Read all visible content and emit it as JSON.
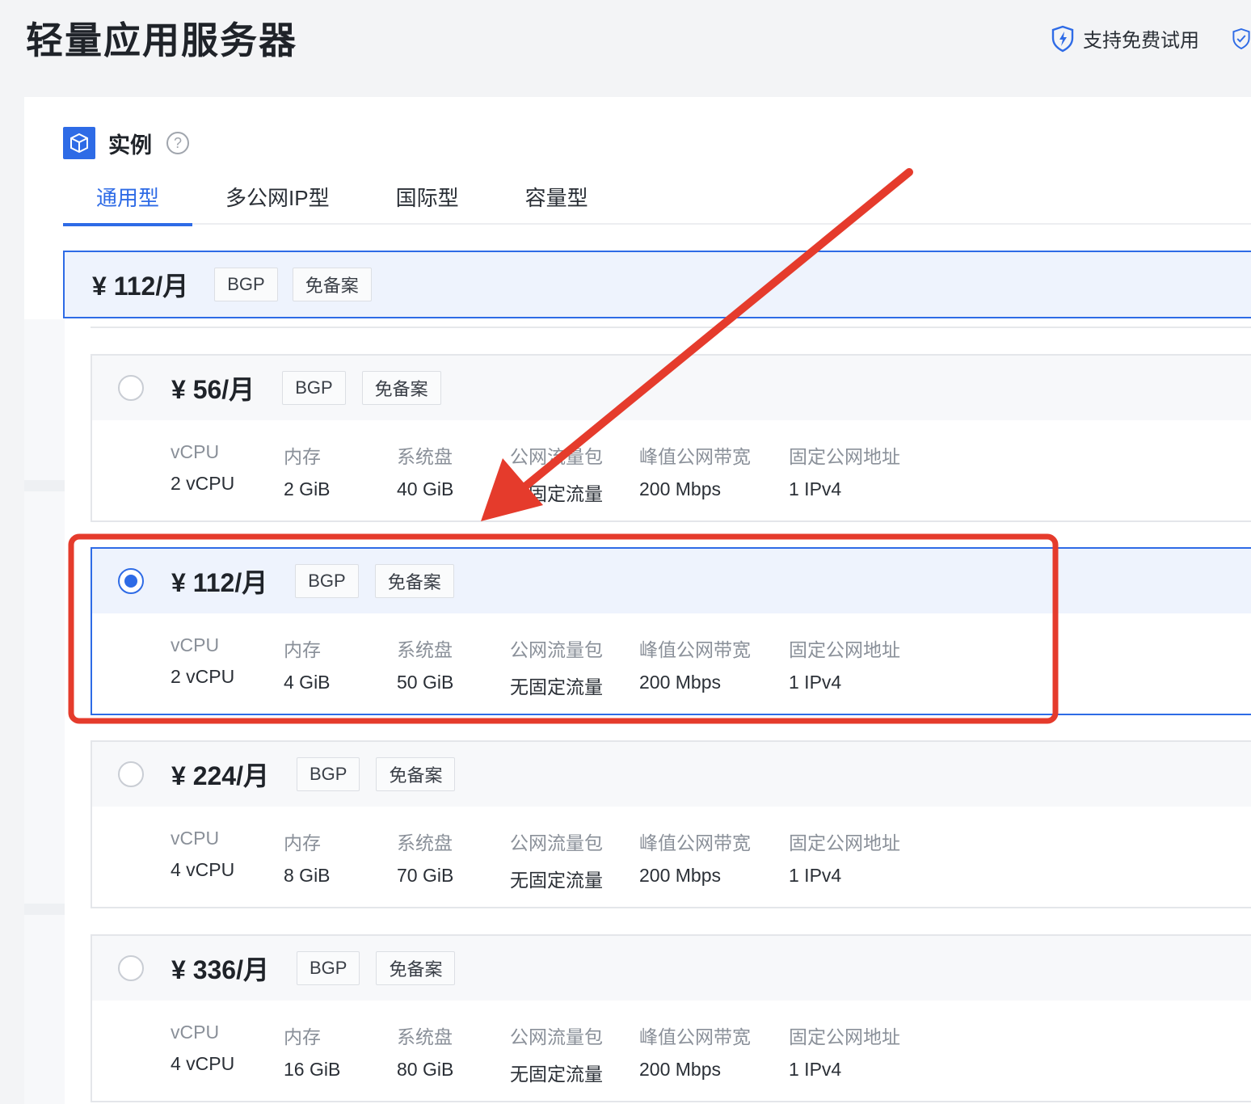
{
  "page": {
    "title": "轻量应用服务器"
  },
  "top_badges": [
    {
      "label": "支持免费试用",
      "icon": "shield-bolt-icon"
    },
    {
      "label": "",
      "icon": "shield-check-icon"
    }
  ],
  "section": {
    "title": "实例",
    "icon": "cube-icon",
    "help": "?"
  },
  "tabs": [
    "通用型",
    "多公网IP型",
    "国际型",
    "容量型"
  ],
  "active_tab": 0,
  "selected": {
    "price": "¥ 112/月",
    "tags": [
      "BGP",
      "免备案"
    ]
  },
  "spec_labels": [
    "vCPU",
    "内存",
    "系统盘",
    "公网流量包",
    "峰值公网带宽",
    "固定公网地址"
  ],
  "plans": [
    {
      "price": "¥ 56/月",
      "tags": [
        "BGP",
        "免备案"
      ],
      "selected": false,
      "values": [
        "2 vCPU",
        "2 GiB",
        "40 GiB",
        "无固定流量",
        "200 Mbps",
        "1 IPv4"
      ]
    },
    {
      "price": "¥ 112/月",
      "tags": [
        "BGP",
        "免备案"
      ],
      "selected": true,
      "values": [
        "2 vCPU",
        "4 GiB",
        "50 GiB",
        "无固定流量",
        "200 Mbps",
        "1 IPv4"
      ]
    },
    {
      "price": "¥ 224/月",
      "tags": [
        "BGP",
        "免备案"
      ],
      "selected": false,
      "values": [
        "4 vCPU",
        "8 GiB",
        "70 GiB",
        "无固定流量",
        "200 Mbps",
        "1 IPv4"
      ]
    },
    {
      "price": "¥ 336/月",
      "tags": [
        "BGP",
        "免备案"
      ],
      "selected": false,
      "values": [
        "4 vCPU",
        "16 GiB",
        "80 GiB",
        "无固定流量",
        "200 Mbps",
        "1 IPv4"
      ]
    }
  ],
  "colors": {
    "accent": "#2e6be6",
    "annotation": "#e53b2c"
  }
}
